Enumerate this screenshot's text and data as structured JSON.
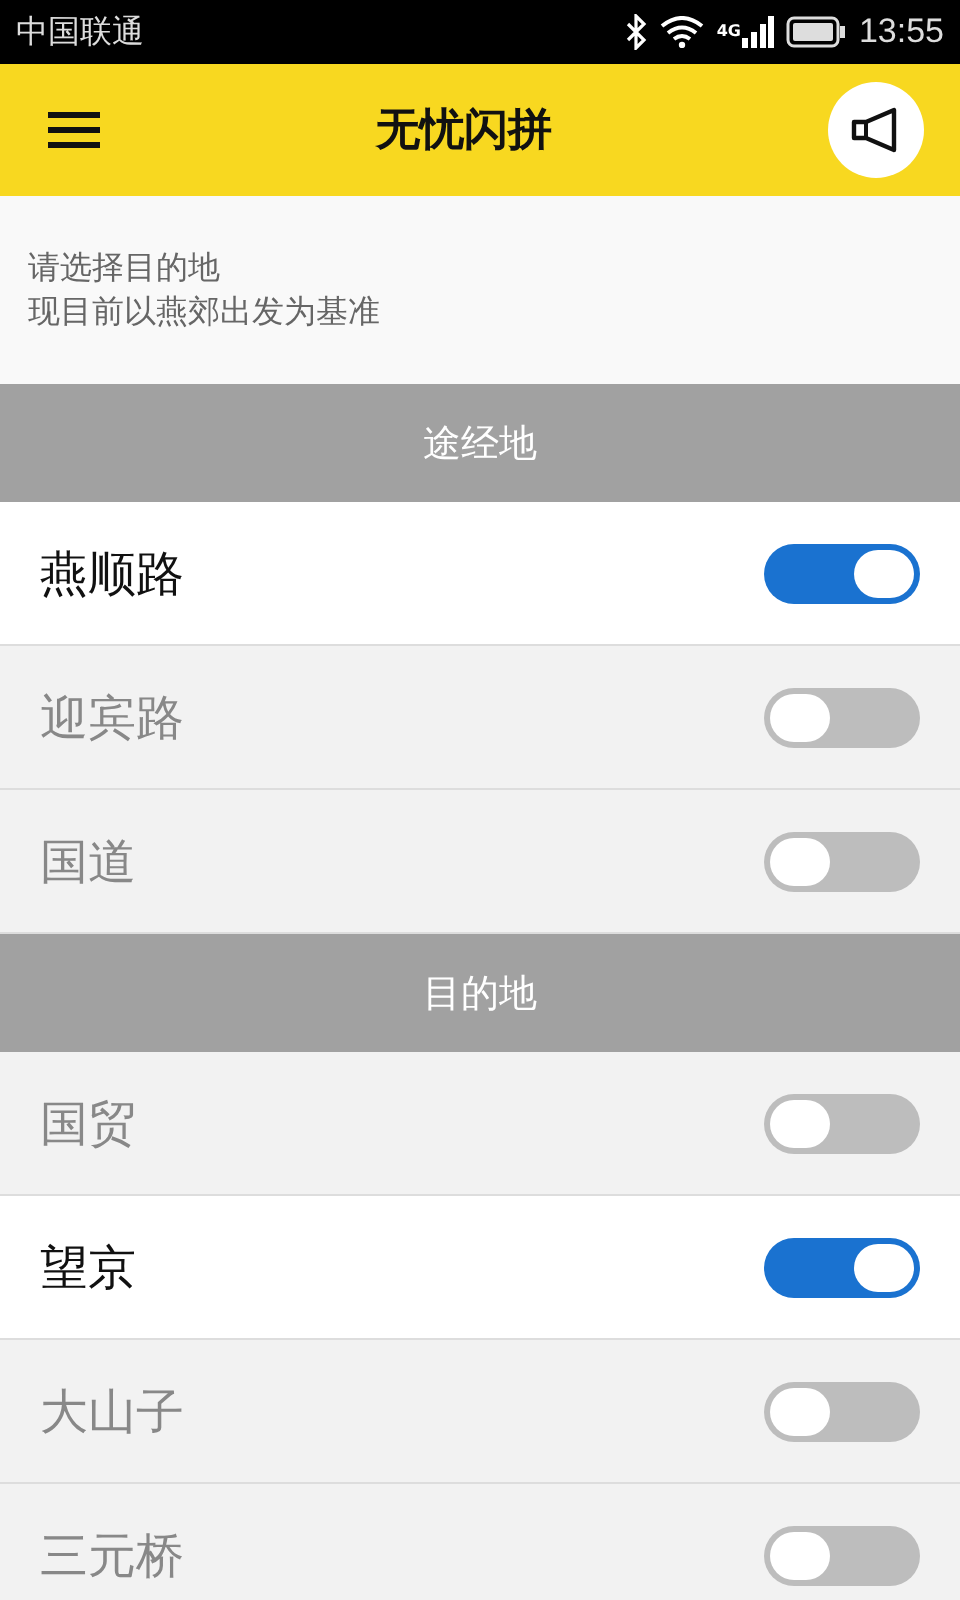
{
  "status_bar": {
    "carrier": "中国联通",
    "network": "4G",
    "time": "13:55"
  },
  "header": {
    "title": "无忧闪拼"
  },
  "notice": {
    "lines": [
      "请选择目的地",
      "现目前以燕郊出发为基准"
    ]
  },
  "sections": [
    {
      "title": "途经地",
      "items": [
        {
          "label": "燕顺路",
          "on": true
        },
        {
          "label": "迎宾路",
          "on": false
        },
        {
          "label": "国道",
          "on": false
        }
      ]
    },
    {
      "title": "目的地",
      "items": [
        {
          "label": "国贸",
          "on": false
        },
        {
          "label": "望京",
          "on": true
        },
        {
          "label": "大山子",
          "on": false
        },
        {
          "label": "三元桥",
          "on": false
        }
      ]
    }
  ]
}
